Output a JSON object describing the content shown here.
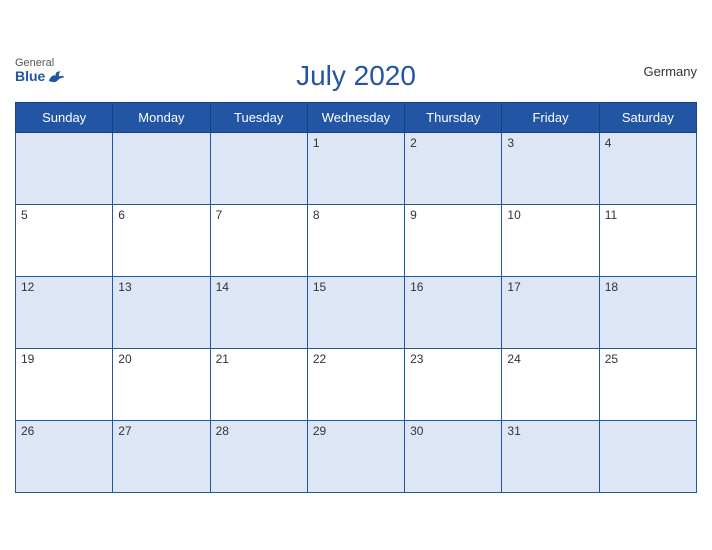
{
  "header": {
    "title": "July 2020",
    "country": "Germany",
    "logo_general": "General",
    "logo_blue": "Blue"
  },
  "weekdays": [
    "Sunday",
    "Monday",
    "Tuesday",
    "Wednesday",
    "Thursday",
    "Friday",
    "Saturday"
  ],
  "weeks": [
    [
      null,
      null,
      null,
      1,
      2,
      3,
      4
    ],
    [
      5,
      6,
      7,
      8,
      9,
      10,
      11
    ],
    [
      12,
      13,
      14,
      15,
      16,
      17,
      18
    ],
    [
      19,
      20,
      21,
      22,
      23,
      24,
      25
    ],
    [
      26,
      27,
      28,
      29,
      30,
      31,
      null
    ]
  ]
}
